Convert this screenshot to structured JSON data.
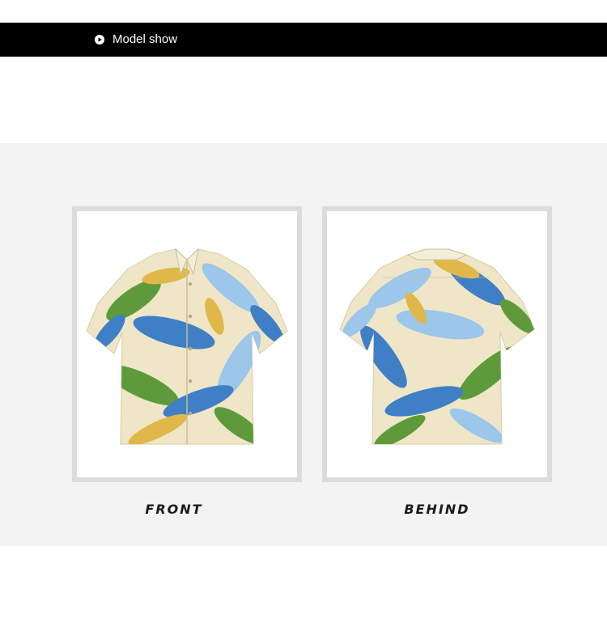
{
  "header": {
    "title": "Model show",
    "icon": "play-circle-icon"
  },
  "views": [
    {
      "caption": "FRONT",
      "icon": "shirt-front-icon"
    },
    {
      "caption": "BEHIND",
      "icon": "shirt-back-icon"
    }
  ],
  "colors": {
    "header_background": "#000000",
    "band_background": "#f3f3f3",
    "frame_border": "#dcdcdc",
    "shirt_base": "#efe6c8",
    "leaf_blue": "#3f7fc6",
    "leaf_light_blue": "#9cc6ea",
    "leaf_green": "#5f9a3a",
    "leaf_yellow": "#e0b84a"
  }
}
